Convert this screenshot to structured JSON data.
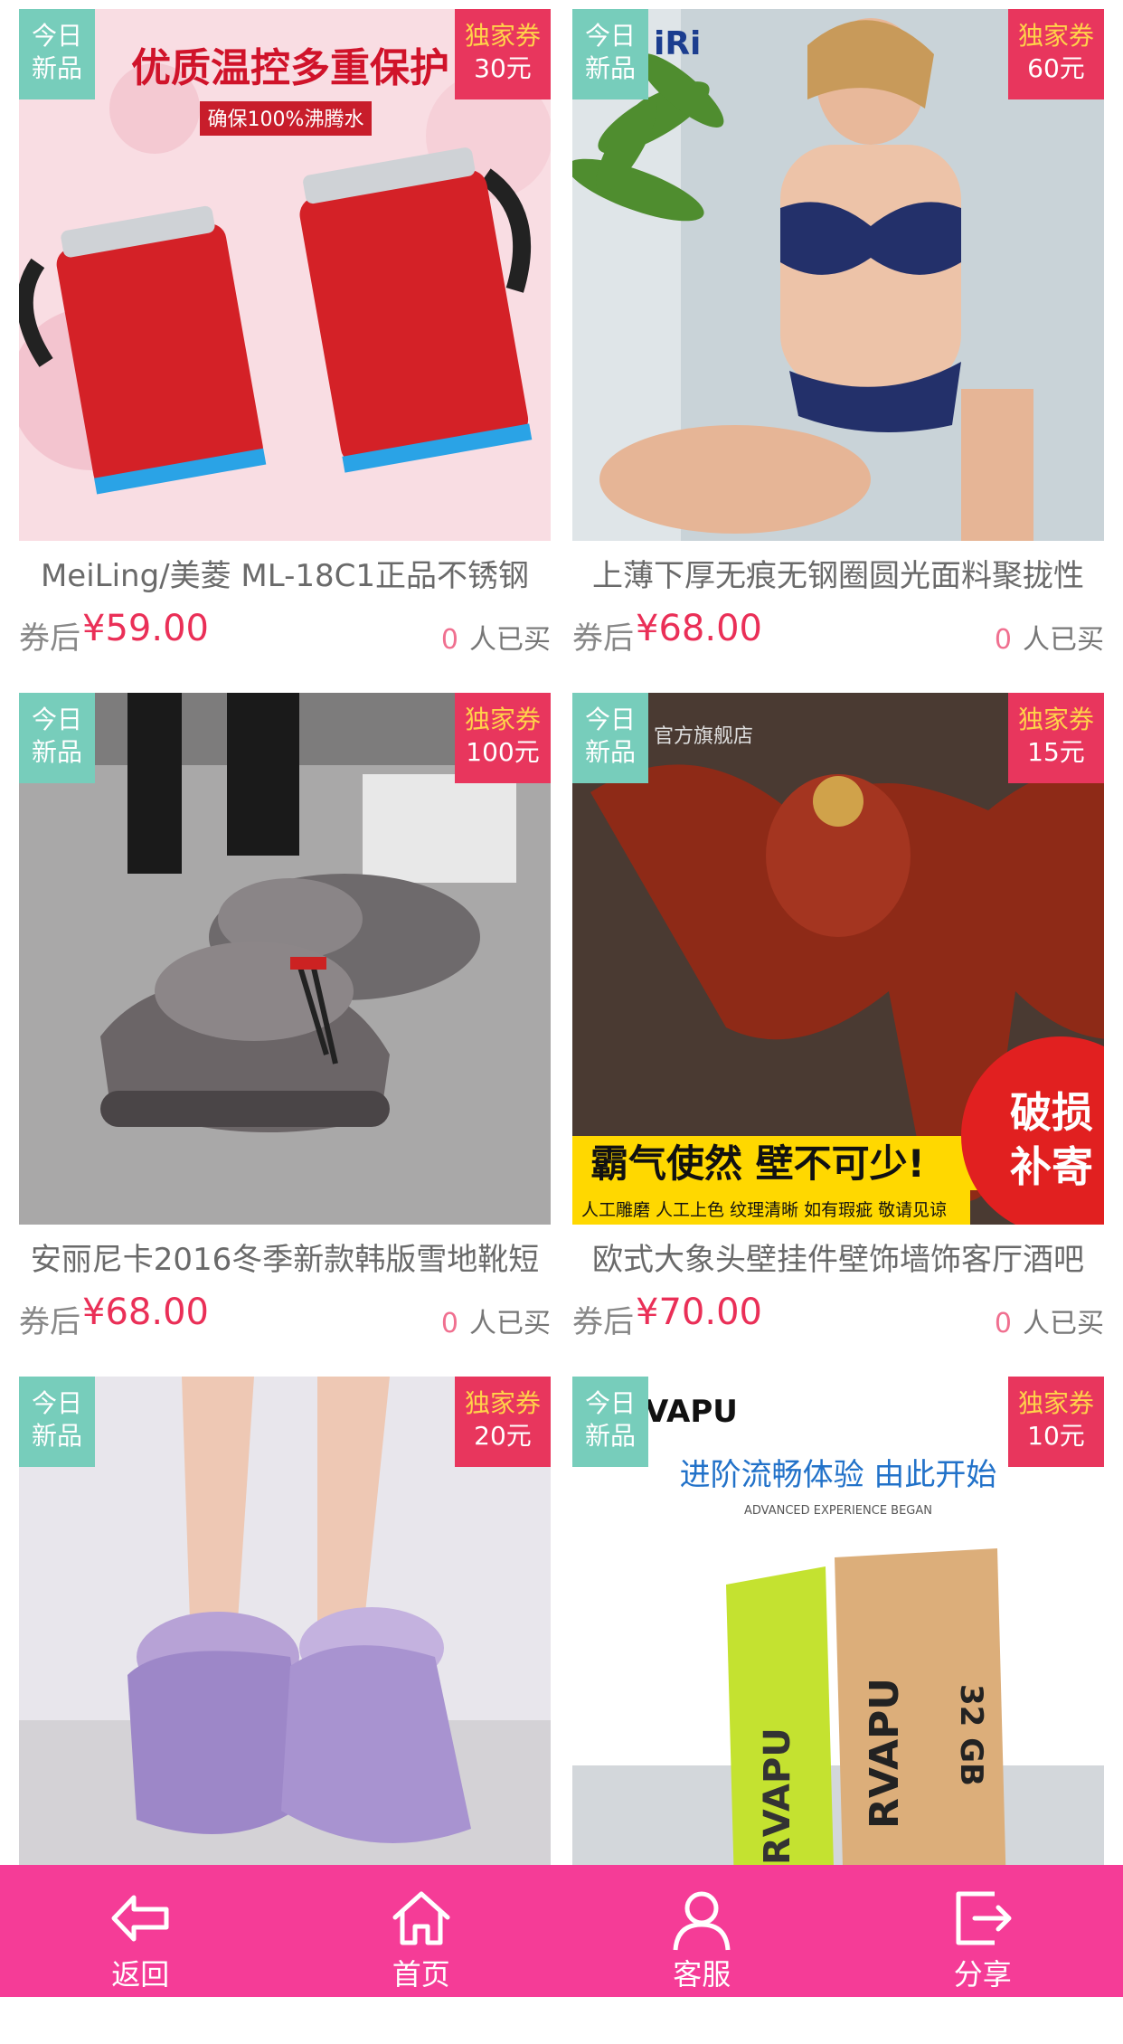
{
  "products": [
    {
      "badge_new_1": "今日",
      "badge_new_2": "新品",
      "coupon_label": "独家券",
      "coupon_value": "30元",
      "title": "MeiLing/美菱 ML-18C1正品不锈钢",
      "price_label": "券后",
      "price": "¥59.00",
      "sold_count": "0",
      "sold_label": "人已买",
      "image_text_1": "优质温控多重保护",
      "image_text_2": "确保100%沸腾水"
    },
    {
      "badge_new_1": "今日",
      "badge_new_2": "新品",
      "coupon_label": "独家券",
      "coupon_value": "60元",
      "title": "上薄下厚无痕无钢圈圆光面料聚拢性",
      "price_label": "券后",
      "price": "¥68.00",
      "sold_count": "0",
      "sold_label": "人已买",
      "image_text_1": "iRi"
    },
    {
      "badge_new_1": "今日",
      "badge_new_2": "新品",
      "coupon_label": "独家券",
      "coupon_value": "100元",
      "title": "安丽尼卡2016冬季新款韩版雪地靴短",
      "price_label": "券后",
      "price": "¥68.00",
      "sold_count": "0",
      "sold_label": "人已买"
    },
    {
      "badge_new_1": "今日",
      "badge_new_2": "新品",
      "coupon_label": "独家券",
      "coupon_value": "15元",
      "title": "欧式大象头壁挂件壁饰墙饰客厅酒吧",
      "price_label": "券后",
      "price": "¥70.00",
      "sold_count": "0",
      "sold_label": "人已买",
      "image_text_1": "霸气使然 壁不可少!",
      "image_text_2": "人工雕磨 人工上色 纹理清晰 如有瑕疵 敬请见谅",
      "image_text_3": "破损",
      "image_text_4": "补寄",
      "image_text_5": "官方旗舰店"
    },
    {
      "badge_new_1": "今日",
      "badge_new_2": "新品",
      "coupon_label": "独家券",
      "coupon_value": "20元"
    },
    {
      "badge_new_1": "今日",
      "badge_new_2": "新品",
      "coupon_label": "独家券",
      "coupon_value": "10元",
      "image_text_1": "VAPU",
      "image_text_2": "进阶流畅体验  由此开始",
      "image_text_3": "ADVANCED EXPERIENCE BEGAN",
      "image_text_4": "RVAPU",
      "image_text_5": "RVAPU",
      "image_text_6": "32 GB"
    }
  ],
  "tabbar": {
    "back": {
      "label": "返回",
      "icon": "back-arrow-icon"
    },
    "home": {
      "label": "首页",
      "icon": "home-icon"
    },
    "service": {
      "label": "客服",
      "icon": "user-icon"
    },
    "share": {
      "label": "分享",
      "icon": "share-icon"
    }
  },
  "colors": {
    "tabbar": "#f53c97",
    "price": "#ea2f57",
    "badge_new": "#77cdbb",
    "badge_coupon": "#e8365d"
  }
}
